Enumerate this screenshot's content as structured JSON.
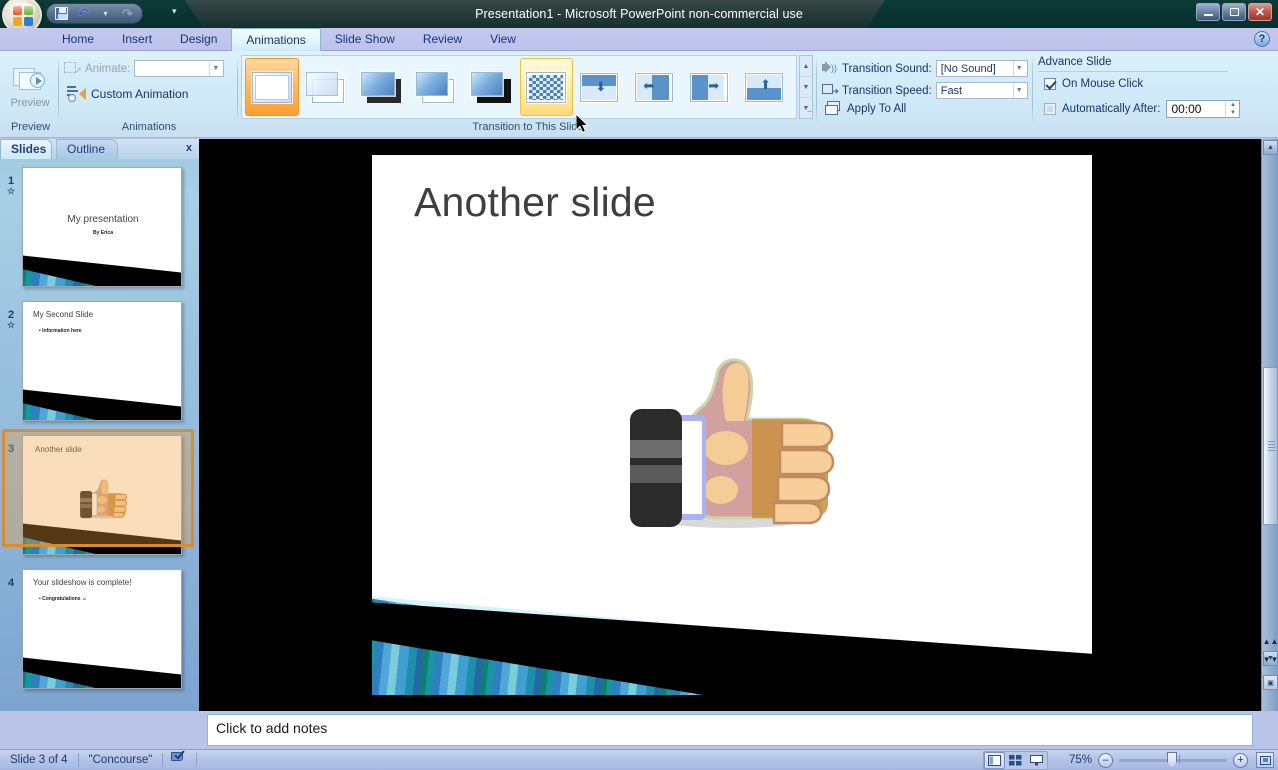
{
  "window": {
    "title": "Presentation1  -  Microsoft PowerPoint non-commercial use",
    "minimize": "–",
    "restore": "❐",
    "close": "X",
    "office_button": "office-orb",
    "qat": {
      "save": "save-icon",
      "undo": "undo-icon",
      "redo": "redo-icon",
      "customize": "customize-qat-icon"
    }
  },
  "tabs": [
    {
      "label": "Home",
      "active": false
    },
    {
      "label": "Insert",
      "active": false
    },
    {
      "label": "Design",
      "active": false
    },
    {
      "label": "Animations",
      "active": true
    },
    {
      "label": "Slide Show",
      "active": false
    },
    {
      "label": "Review",
      "active": false
    },
    {
      "label": "View",
      "active": false
    }
  ],
  "help": {
    "label": "?"
  },
  "ribbon": {
    "preview_group": {
      "title": "Preview",
      "button_label": "Preview",
      "icon": "preview-icon"
    },
    "animations_group": {
      "title": "Animations",
      "animate_label": "Animate:",
      "animate_value": "",
      "animate_icon": "animate-icon",
      "custom_animation_label": "Custom Animation",
      "custom_animation_icon": "custom-animation-icon"
    },
    "transition_group": {
      "title": "Transition to This Slide",
      "items": [
        {
          "name": "No Transition",
          "type": "none",
          "state": "selected"
        },
        {
          "name": "Blinds",
          "type": "blinds",
          "state": "normal"
        },
        {
          "name": "Box In",
          "type": "box-in",
          "state": "normal"
        },
        {
          "name": "Checkerboard",
          "type": "checkerboard",
          "state": "normal"
        },
        {
          "name": "Comb",
          "type": "comb",
          "state": "normal"
        },
        {
          "name": "Dissolve",
          "type": "dissolve",
          "state": "hover"
        },
        {
          "name": "Wipe Down",
          "type": "wipe-down",
          "state": "normal"
        },
        {
          "name": "Wipe Left",
          "type": "wipe-left",
          "state": "normal"
        },
        {
          "name": "Wipe Right",
          "type": "wipe-right",
          "state": "normal"
        },
        {
          "name": "Wipe Up",
          "type": "wipe-up",
          "state": "normal"
        }
      ],
      "scroll_up": "▲",
      "scroll_down": "▼",
      "more": "▤"
    },
    "options_group": {
      "sound_label": "Transition Sound:",
      "sound_value": "[No Sound]",
      "speed_label": "Transition Speed:",
      "speed_value": "Fast",
      "apply_all_label": "Apply To All",
      "sound_icon": "sound-icon",
      "speed_icon": "speed-icon",
      "apply_all_icon": "apply-to-all-icon"
    },
    "advance_group": {
      "title": "Advance Slide",
      "on_mouse_click_label": "On Mouse Click",
      "on_mouse_click_checked": true,
      "auto_after_label": "Automatically After:",
      "auto_after_checked": false,
      "auto_after_value": "00:00"
    }
  },
  "left_pane": {
    "tab_slides": "Slides",
    "tab_outline": "Outline",
    "close": "x",
    "slides": [
      {
        "number": "1",
        "title": "My presentation",
        "subtitle": "By Erica",
        "layout": "title",
        "selected": false,
        "has_transition": true
      },
      {
        "number": "2",
        "title": "My Second Slide",
        "bullet": "Information here",
        "layout": "content",
        "selected": false,
        "has_transition": true
      },
      {
        "number": "3",
        "title": "Another slide",
        "bullet": "",
        "layout": "image",
        "selected": true,
        "has_transition": false
      },
      {
        "number": "4",
        "title": "Your slideshow is complete!",
        "bullet": "Congratulations ☺",
        "layout": "content",
        "selected": false,
        "has_transition": false
      }
    ]
  },
  "slide_editor": {
    "title": "Another slide",
    "image": "thumbs-up-clipart",
    "theme": "Concourse"
  },
  "notes": {
    "placeholder": "Click to add notes"
  },
  "scrollbar": {
    "up": "▲",
    "down": "▼",
    "prev_slide": "▲▲",
    "next_slide": "▼▼"
  },
  "status_bar": {
    "slide_counter": "Slide 3 of 4",
    "theme": "\"Concourse\"",
    "spellcheck_icon": "spellcheck-icon",
    "views": [
      {
        "name": "normal-view",
        "active": true
      },
      {
        "name": "slide-sorter-view",
        "active": false
      },
      {
        "name": "slide-show-view",
        "active": false
      }
    ],
    "zoom_level": "75%",
    "zoom_out": "–",
    "zoom_in": "+",
    "fit_to_window": "fit-to-window-icon"
  },
  "colors": {
    "title_bar": "#0a3532",
    "ribbon": "#cfe8f6",
    "accent_selected": "#ff9e33",
    "accent_hover": "#ffef9e",
    "theme_teal": "#0f7f72",
    "theme_blue": "#2f7fc0",
    "theme_cyan": "#79ccd8"
  }
}
